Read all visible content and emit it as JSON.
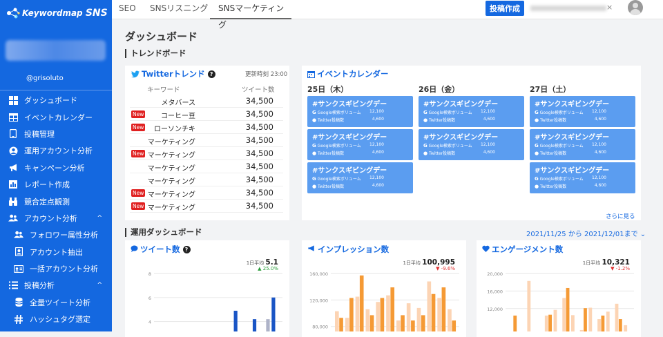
{
  "app": {
    "logo_text": "Keywordmap",
    "logo_suffix": "SNS",
    "username": "@grisoluto"
  },
  "sidebar": {
    "items": [
      {
        "label": "ダッシュボード",
        "icon": "dashboard-icon"
      },
      {
        "label": "イベントカレンダー",
        "icon": "calendar-table-icon"
      },
      {
        "label": "投稿管理",
        "icon": "tablet-icon"
      },
      {
        "label": "運用アカウント分析",
        "icon": "user-circle-icon"
      },
      {
        "label": "キャンペーン分析",
        "icon": "megaphone-icon"
      },
      {
        "label": "レポート作成",
        "icon": "bar-chart-icon"
      },
      {
        "label": "競合定点観測",
        "icon": "binoculars-icon"
      },
      {
        "label": "アカウント分析",
        "icon": "users-icon",
        "caret": "^"
      },
      {
        "label": "フォロワー属性分析",
        "icon": "users-icon",
        "sub": true
      },
      {
        "label": "アカウント抽出",
        "icon": "portrait-icon",
        "sub": true
      },
      {
        "label": "一括アカウント分析",
        "icon": "id-card-icon",
        "sub": true
      },
      {
        "label": "投稿分析",
        "icon": "list-icon",
        "caret": "^"
      },
      {
        "label": "全量ツイート分析",
        "icon": "database-icon",
        "sub": true
      },
      {
        "label": "ハッシュタグ選定",
        "icon": "hashtag-icon",
        "sub": true
      }
    ]
  },
  "topbar": {
    "tabs": [
      "SEO",
      "SNSリスニング",
      "SNSマーケティング"
    ],
    "post_button": "投稿作成",
    "clear": "×"
  },
  "page": {
    "title": "ダッシュボード"
  },
  "trend": {
    "section_title": "トレンドボード",
    "twitter_title": "Twitterトレンド",
    "updated": "更新時刻 23:00",
    "headers": {
      "keyword": "キーワード",
      "tweets": "ツイート数"
    },
    "rows": [
      {
        "keyword": "メタバース",
        "count": "34,500",
        "new": false
      },
      {
        "keyword": "コーヒー豆",
        "count": "34,500",
        "new": true
      },
      {
        "keyword": "ローソンチキ",
        "count": "34,500",
        "new": true
      },
      {
        "keyword": "マーケティング",
        "count": "34,500",
        "new": false
      },
      {
        "keyword": "マーケティング",
        "count": "34,500",
        "new": true
      },
      {
        "keyword": "マーケティング",
        "count": "34,500",
        "new": false
      },
      {
        "keyword": "マーケティング",
        "count": "34,500",
        "new": false
      },
      {
        "keyword": "マーケティング",
        "count": "34,500",
        "new": true
      },
      {
        "keyword": "マーケティング",
        "count": "34,500",
        "new": true
      }
    ],
    "new_label": "New"
  },
  "calendar": {
    "title": "イベントカレンダー",
    "days": [
      {
        "label": "25日（木）",
        "events": 3
      },
      {
        "label": "26日（金）",
        "events": 2
      },
      {
        "label": "27日（土）",
        "events": 3
      }
    ],
    "event": {
      "name": "#サンクスギビングデー",
      "google_label": "Google検索ボリューム",
      "google_value": "12,100",
      "twitter_label": "Twitter投稿数",
      "twitter_value": "4,600"
    },
    "see_more": "さらに見る"
  },
  "ops": {
    "section_title": "運用ダッシュボード",
    "date_range": "2021/11/25 から 2021/12/01まで ⌄"
  },
  "charts": [
    {
      "title": "ツイート数",
      "avg_label": "1日平均",
      "avg": "5.1",
      "change": "▲ 25.0%",
      "change_color": "#2a9d3a",
      "help": true
    },
    {
      "title": "インプレッション数",
      "avg_label": "1日平均",
      "avg": "100,995",
      "change": "▼ -9.6%",
      "change_color": "#e03030",
      "help": false
    },
    {
      "title": "エンゲージメント数",
      "avg_label": "1日平均",
      "avg": "10,321",
      "change": "▼ -1.2%",
      "change_color": "#e03030",
      "help": false
    }
  ],
  "chart_data": [
    {
      "type": "bar",
      "title": "ツイート数",
      "yticks": [
        "8",
        "6",
        "4"
      ],
      "series": [
        {
          "values": [
            0.3,
            0.3,
            0,
            1.4,
            0,
            1.4,
            1.5,
            2.3,
            4.9,
            2.5,
            4.2,
            1.4,
            6
          ]
        },
        {
          "values": [
            0,
            0.3,
            1.4,
            0,
            1.4,
            0,
            0,
            2.3,
            0,
            1.4,
            0,
            4.2,
            1.4
          ]
        }
      ],
      "colors": [
        "#1a55c5",
        "#aeb3c8"
      ],
      "ylim": [
        2.6,
        8
      ]
    },
    {
      "type": "bar",
      "title": "インプレッション数",
      "yticks": [
        "160,000",
        "120,000",
        "80,000"
      ],
      "series": [
        {
          "values": [
            103000,
            93000,
            125000,
            106000,
            117000,
            127000,
            89000,
            115000,
            108000,
            148000,
            123000,
            106000
          ]
        },
        {
          "values": [
            93000,
            123000,
            157000,
            97000,
            123000,
            139000,
            97000,
            89000,
            97000,
            129000,
            139000,
            89000
          ]
        }
      ],
      "colors": [
        "#fcd4b4",
        "#f59a35"
      ],
      "ylim": [
        62000,
        160000
      ]
    },
    {
      "type": "bar",
      "title": "エンゲージメント数",
      "yticks": [
        "20,000",
        "16,000",
        "12,000"
      ],
      "series": [
        {
          "values": [
            6200,
            0,
            18300,
            0,
            10400,
            11700,
            14400,
            10500,
            7100,
            12200,
            9600,
            11300,
            13100,
            8200
          ]
        },
        {
          "values": [
            10400,
            0,
            0,
            0,
            10600,
            0,
            16700,
            0,
            12100,
            0,
            10400,
            0,
            9600,
            0
          ]
        }
      ],
      "colors": [
        "#fcd4b4",
        "#f59a35"
      ],
      "ylim": [
        5200,
        20000
      ]
    }
  ]
}
